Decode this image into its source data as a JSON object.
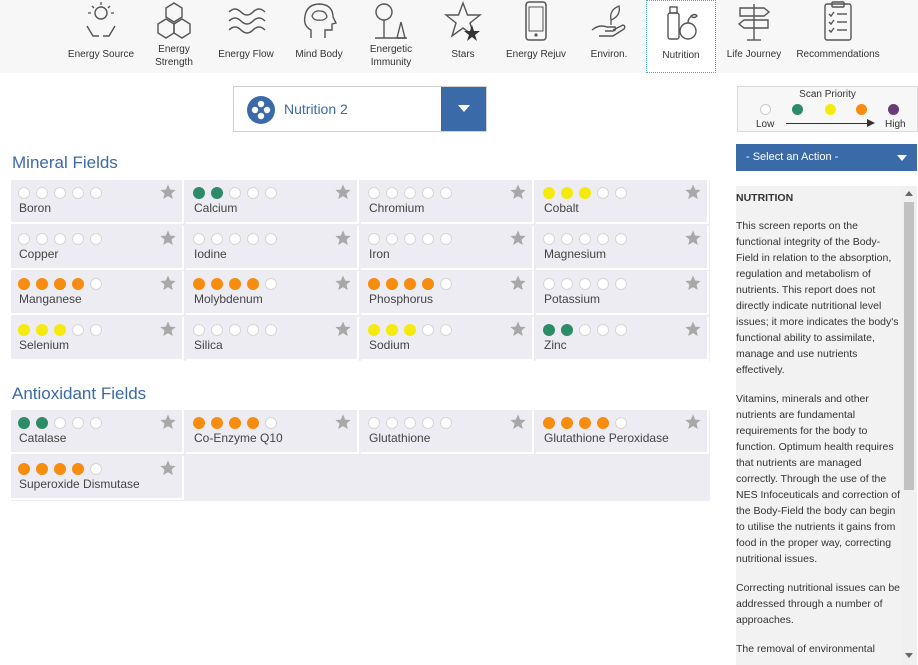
{
  "nav": [
    {
      "label": "Energy Source",
      "icon": "sun-hands-icon"
    },
    {
      "label": "Energy\nStrength",
      "icon": "hexagons-icon"
    },
    {
      "label": "Energy Flow",
      "icon": "waves-icon"
    },
    {
      "label": "Mind Body",
      "icon": "head-brain-icon"
    },
    {
      "label": "Energetic\nImmunity",
      "icon": "tree-shield-icon"
    },
    {
      "label": "Stars",
      "icon": "star-icon"
    },
    {
      "label": "Energy Rejuv",
      "icon": "phone-icon"
    },
    {
      "label": "Environ.",
      "icon": "hand-leaf-icon"
    },
    {
      "label": "Nutrition",
      "icon": "fruit-bottle-icon"
    },
    {
      "label": "Life Journey",
      "icon": "signpost-icon"
    },
    {
      "label": "Recommendations",
      "icon": "clipboard-icon"
    }
  ],
  "field_select": {
    "value": "Nutrition 2"
  },
  "legend": {
    "title": "Scan Priority",
    "low": "Low",
    "high": "High",
    "colors": [
      "#ffffff",
      "#2e8b68",
      "#f5ea10",
      "#f78c0f",
      "#6b3a78"
    ]
  },
  "sections": {
    "mineral": {
      "title": "Mineral Fields",
      "items": [
        {
          "name": "Boron",
          "level": 0,
          "color": "none"
        },
        {
          "name": "Calcium",
          "level": 2,
          "color": "green"
        },
        {
          "name": "Chromium",
          "level": 0,
          "color": "none"
        },
        {
          "name": "Cobalt",
          "level": 3,
          "color": "yellow"
        },
        {
          "name": "Copper",
          "level": 0,
          "color": "none"
        },
        {
          "name": "Iodine",
          "level": 0,
          "color": "none"
        },
        {
          "name": "Iron",
          "level": 0,
          "color": "none"
        },
        {
          "name": "Magnesium",
          "level": 0,
          "color": "none"
        },
        {
          "name": "Manganese",
          "level": 4,
          "color": "orange"
        },
        {
          "name": "Molybdenum",
          "level": 4,
          "color": "orange"
        },
        {
          "name": "Phosphorus",
          "level": 4,
          "color": "orange"
        },
        {
          "name": "Potassium",
          "level": 0,
          "color": "none"
        },
        {
          "name": "Selenium",
          "level": 3,
          "color": "yellow"
        },
        {
          "name": "Silica",
          "level": 0,
          "color": "none"
        },
        {
          "name": "Sodium",
          "level": 3,
          "color": "yellow"
        },
        {
          "name": "Zinc",
          "level": 2,
          "color": "green"
        }
      ]
    },
    "antioxidant": {
      "title": "Antioxidant Fields",
      "items": [
        {
          "name": "Catalase",
          "level": 2,
          "color": "green"
        },
        {
          "name": "Co-Enzyme Q10",
          "level": 4,
          "color": "orange"
        },
        {
          "name": "Glutathione",
          "level": 0,
          "color": "none"
        },
        {
          "name": "Glutathione Peroxidase",
          "level": 4,
          "color": "orange"
        },
        {
          "name": "Superoxide Dismutase",
          "level": 4,
          "color": "orange"
        }
      ]
    }
  },
  "action": {
    "label": "- Select an Action -"
  },
  "info": {
    "heading": "NUTRITION",
    "paragraphs": [
      "This screen reports on the functional integrity of the Body-Field in relation to the absorption, regulation and metabolism of nutrients. This report does not directly indicate nutritional level issues; it more indicates the body's functional ability to assimilate, manage and use nutrients effectively.",
      "Vitamins, minerals and other nutrients are fundamental requirements for the body to function. Optimum health requires that nutrients are managed correctly. Through the use of the NES Infoceuticals and correction of the Body-Field the body can begin to utilise the nutrients it gains from food in the proper way, correcting nutritional issues.",
      "Correcting nutritional issues can be addressed through a number of approaches.",
      "The removal of environmental"
    ]
  }
}
